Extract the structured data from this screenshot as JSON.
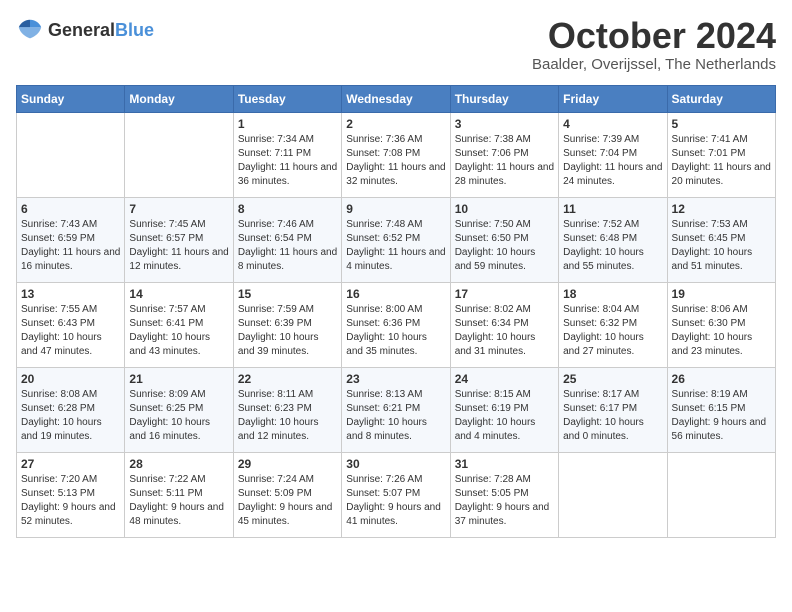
{
  "header": {
    "logo_general": "General",
    "logo_blue": "Blue",
    "month_year": "October 2024",
    "location": "Baalder, Overijssel, The Netherlands"
  },
  "weekdays": [
    "Sunday",
    "Monday",
    "Tuesday",
    "Wednesday",
    "Thursday",
    "Friday",
    "Saturday"
  ],
  "weeks": [
    [
      {
        "day": "",
        "info": ""
      },
      {
        "day": "",
        "info": ""
      },
      {
        "day": "1",
        "info": "Sunrise: 7:34 AM\nSunset: 7:11 PM\nDaylight: 11 hours and 36 minutes."
      },
      {
        "day": "2",
        "info": "Sunrise: 7:36 AM\nSunset: 7:08 PM\nDaylight: 11 hours and 32 minutes."
      },
      {
        "day": "3",
        "info": "Sunrise: 7:38 AM\nSunset: 7:06 PM\nDaylight: 11 hours and 28 minutes."
      },
      {
        "day": "4",
        "info": "Sunrise: 7:39 AM\nSunset: 7:04 PM\nDaylight: 11 hours and 24 minutes."
      },
      {
        "day": "5",
        "info": "Sunrise: 7:41 AM\nSunset: 7:01 PM\nDaylight: 11 hours and 20 minutes."
      }
    ],
    [
      {
        "day": "6",
        "info": "Sunrise: 7:43 AM\nSunset: 6:59 PM\nDaylight: 11 hours and 16 minutes."
      },
      {
        "day": "7",
        "info": "Sunrise: 7:45 AM\nSunset: 6:57 PM\nDaylight: 11 hours and 12 minutes."
      },
      {
        "day": "8",
        "info": "Sunrise: 7:46 AM\nSunset: 6:54 PM\nDaylight: 11 hours and 8 minutes."
      },
      {
        "day": "9",
        "info": "Sunrise: 7:48 AM\nSunset: 6:52 PM\nDaylight: 11 hours and 4 minutes."
      },
      {
        "day": "10",
        "info": "Sunrise: 7:50 AM\nSunset: 6:50 PM\nDaylight: 10 hours and 59 minutes."
      },
      {
        "day": "11",
        "info": "Sunrise: 7:52 AM\nSunset: 6:48 PM\nDaylight: 10 hours and 55 minutes."
      },
      {
        "day": "12",
        "info": "Sunrise: 7:53 AM\nSunset: 6:45 PM\nDaylight: 10 hours and 51 minutes."
      }
    ],
    [
      {
        "day": "13",
        "info": "Sunrise: 7:55 AM\nSunset: 6:43 PM\nDaylight: 10 hours and 47 minutes."
      },
      {
        "day": "14",
        "info": "Sunrise: 7:57 AM\nSunset: 6:41 PM\nDaylight: 10 hours and 43 minutes."
      },
      {
        "day": "15",
        "info": "Sunrise: 7:59 AM\nSunset: 6:39 PM\nDaylight: 10 hours and 39 minutes."
      },
      {
        "day": "16",
        "info": "Sunrise: 8:00 AM\nSunset: 6:36 PM\nDaylight: 10 hours and 35 minutes."
      },
      {
        "day": "17",
        "info": "Sunrise: 8:02 AM\nSunset: 6:34 PM\nDaylight: 10 hours and 31 minutes."
      },
      {
        "day": "18",
        "info": "Sunrise: 8:04 AM\nSunset: 6:32 PM\nDaylight: 10 hours and 27 minutes."
      },
      {
        "day": "19",
        "info": "Sunrise: 8:06 AM\nSunset: 6:30 PM\nDaylight: 10 hours and 23 minutes."
      }
    ],
    [
      {
        "day": "20",
        "info": "Sunrise: 8:08 AM\nSunset: 6:28 PM\nDaylight: 10 hours and 19 minutes."
      },
      {
        "day": "21",
        "info": "Sunrise: 8:09 AM\nSunset: 6:25 PM\nDaylight: 10 hours and 16 minutes."
      },
      {
        "day": "22",
        "info": "Sunrise: 8:11 AM\nSunset: 6:23 PM\nDaylight: 10 hours and 12 minutes."
      },
      {
        "day": "23",
        "info": "Sunrise: 8:13 AM\nSunset: 6:21 PM\nDaylight: 10 hours and 8 minutes."
      },
      {
        "day": "24",
        "info": "Sunrise: 8:15 AM\nSunset: 6:19 PM\nDaylight: 10 hours and 4 minutes."
      },
      {
        "day": "25",
        "info": "Sunrise: 8:17 AM\nSunset: 6:17 PM\nDaylight: 10 hours and 0 minutes."
      },
      {
        "day": "26",
        "info": "Sunrise: 8:19 AM\nSunset: 6:15 PM\nDaylight: 9 hours and 56 minutes."
      }
    ],
    [
      {
        "day": "27",
        "info": "Sunrise: 7:20 AM\nSunset: 5:13 PM\nDaylight: 9 hours and 52 minutes."
      },
      {
        "day": "28",
        "info": "Sunrise: 7:22 AM\nSunset: 5:11 PM\nDaylight: 9 hours and 48 minutes."
      },
      {
        "day": "29",
        "info": "Sunrise: 7:24 AM\nSunset: 5:09 PM\nDaylight: 9 hours and 45 minutes."
      },
      {
        "day": "30",
        "info": "Sunrise: 7:26 AM\nSunset: 5:07 PM\nDaylight: 9 hours and 41 minutes."
      },
      {
        "day": "31",
        "info": "Sunrise: 7:28 AM\nSunset: 5:05 PM\nDaylight: 9 hours and 37 minutes."
      },
      {
        "day": "",
        "info": ""
      },
      {
        "day": "",
        "info": ""
      }
    ]
  ]
}
